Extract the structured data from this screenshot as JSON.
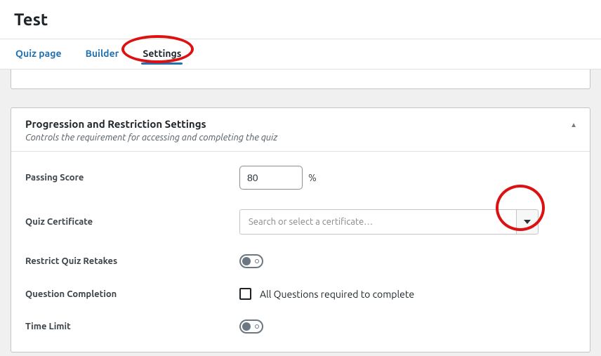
{
  "header": {
    "title": "Test"
  },
  "tabs": {
    "items": [
      {
        "label": "Quiz page"
      },
      {
        "label": "Builder"
      },
      {
        "label": "Settings"
      }
    ],
    "active_index": 2
  },
  "panel": {
    "title": "Progression and Restriction Settings",
    "subtitle": "Controls the requirement for accessing and completing the quiz",
    "fields": {
      "passing_score": {
        "label": "Passing Score",
        "value": "80",
        "unit": "%"
      },
      "certificate": {
        "label": "Quiz Certificate",
        "placeholder": "Search or select a certificate…"
      },
      "restrict_retakes": {
        "label": "Restrict Quiz Retakes",
        "on": false
      },
      "question_completion": {
        "label": "Question Completion",
        "checkbox_label": "All Questions required to complete",
        "checked": false
      },
      "time_limit": {
        "label": "Time Limit",
        "on": false
      }
    }
  }
}
